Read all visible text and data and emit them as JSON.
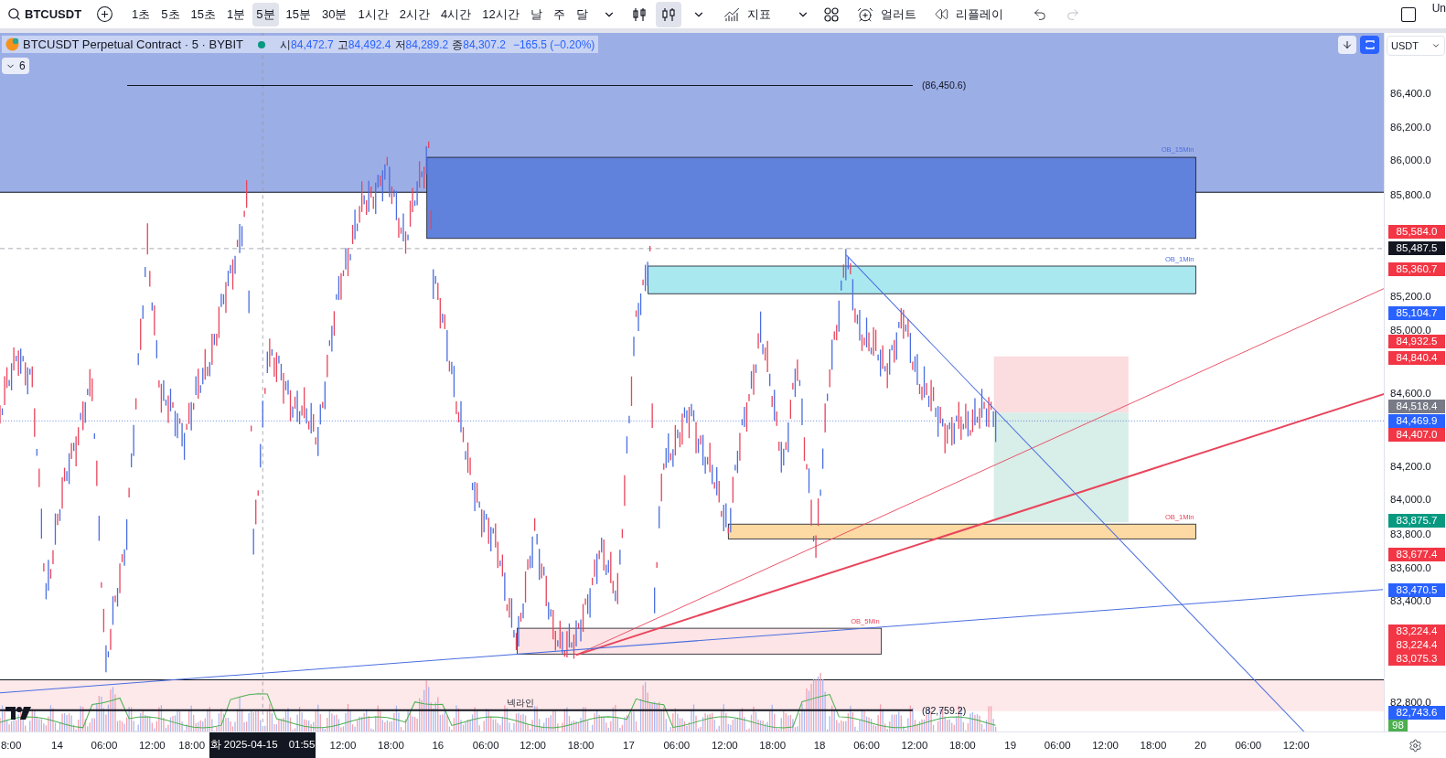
{
  "toolbar": {
    "symbol": "BTCUSDT",
    "intervals": [
      {
        "label": "1초",
        "selected": false
      },
      {
        "label": "5초",
        "selected": false
      },
      {
        "label": "15초",
        "selected": false
      },
      {
        "label": "1분",
        "selected": false
      },
      {
        "label": "5분",
        "selected": true
      },
      {
        "label": "15분",
        "selected": false
      },
      {
        "label": "30분",
        "selected": false
      },
      {
        "label": "1시간",
        "selected": false
      },
      {
        "label": "2시간",
        "selected": false
      },
      {
        "label": "4시간",
        "selected": false
      },
      {
        "label": "12시간",
        "selected": false
      },
      {
        "label": "날",
        "selected": false
      },
      {
        "label": "주",
        "selected": false
      },
      {
        "label": "달",
        "selected": false
      }
    ],
    "chart_types": [
      {
        "kind": "bars",
        "selected": false
      },
      {
        "kind": "candles",
        "selected": true
      }
    ],
    "indicators": "지표",
    "alert": "얼러트",
    "replay": "리플레이",
    "cut_text": "Un"
  },
  "legend": {
    "title": "BTCUSDT Perpetual Contract · 5 · BYBIT",
    "ohlc": [
      {
        "label": "시",
        "value": "84,472.7"
      },
      {
        "label": "고",
        "value": "84,492.4"
      },
      {
        "label": "저",
        "value": "84,289.2"
      },
      {
        "label": "종",
        "value": "84,307.2"
      }
    ],
    "change": "−165.5 (−0.20%)",
    "indicator_count": "6"
  },
  "chart": {
    "levels": [
      {
        "label": "(86,450.6)"
      },
      {
        "label": "(82,759.2)"
      }
    ],
    "zones": [
      {
        "label": "OB_15Min",
        "color": "#6182dc"
      },
      {
        "label": "OB_1Min",
        "color": "#aae8f0"
      },
      {
        "label": "OB_1Min",
        "color": "#fddaa3"
      },
      {
        "label": "OB_5Min",
        "color": "#fde4e6"
      }
    ],
    "neckline": "넥라인"
  },
  "price_axis": {
    "currency": "USDT",
    "ticks": [
      "86,400.0",
      "86,200.0",
      "86,000.0",
      "85,800.0",
      "85,200.0",
      "85,000.0",
      "84,600.0",
      "84,200.0",
      "84,000.0",
      "83,800.0",
      "83,600.0",
      "83,400.0",
      "82,800.0"
    ],
    "badges": [
      {
        "text": "85,584.0",
        "color": "#f23645"
      },
      {
        "text": "85,487.5",
        "color": "#131722"
      },
      {
        "text": "85,360.7",
        "color": "#f23645"
      },
      {
        "text": "85,104.7",
        "color": "#2962ff"
      },
      {
        "text": "84,932.5",
        "color": "#f23645"
      },
      {
        "text": "84,840.4",
        "color": "#f23645"
      },
      {
        "text": "84,518.4",
        "color": "#787b86"
      },
      {
        "text": "84,469.9",
        "color": "#2962ff"
      },
      {
        "text": "84,407.0",
        "color": "#f23645"
      },
      {
        "text": "83,875.7",
        "color": "#089981"
      },
      {
        "text": "83,677.4",
        "color": "#f23645"
      },
      {
        "text": "83,470.5",
        "color": "#2962ff"
      },
      {
        "text": "83,224.4",
        "color": "#f23645"
      },
      {
        "text": "83,224.4",
        "color": "#f23645"
      },
      {
        "text": "83,075.3",
        "color": "#f23645"
      },
      {
        "text": "82,743.6",
        "color": "#2962ff"
      }
    ],
    "counter": {
      "text": "98",
      "color": "#4caf50"
    }
  },
  "time_axis": {
    "labels": [
      "8:00",
      "14",
      "06:00",
      "12:00",
      "18:00",
      "12:00",
      "18:00",
      "16",
      "06:00",
      "12:00",
      "18:00",
      "17",
      "06:00",
      "12:00",
      "18:00",
      "18",
      "06:00",
      "12:00",
      "18:00",
      "19",
      "06:00",
      "12:00",
      "18:00",
      "20",
      "06:00",
      "12:00"
    ],
    "cursor_date": "화 2025-04-15",
    "cursor_time": "01:55"
  }
}
